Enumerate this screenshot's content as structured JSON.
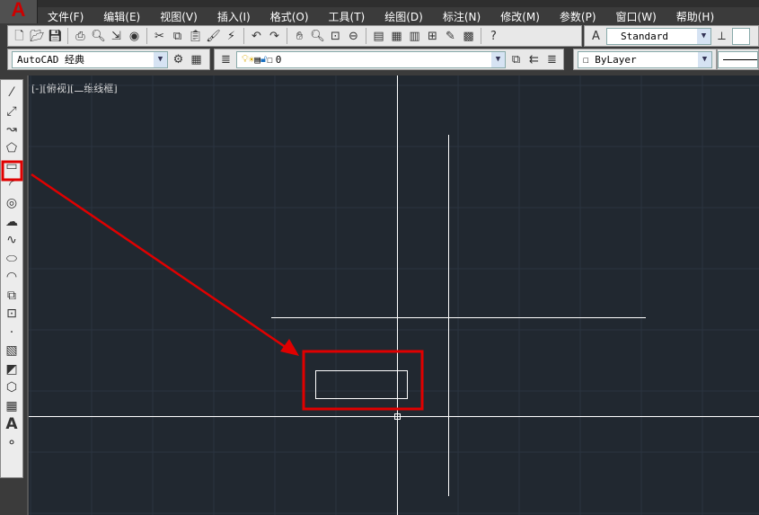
{
  "app": {
    "logo_letter": "A"
  },
  "menu": [
    "文件(F)",
    "编辑(E)",
    "视图(V)",
    "插入(I)",
    "格式(O)",
    "工具(T)",
    "绘图(D)",
    "标注(N)",
    "修改(M)",
    "参数(P)",
    "窗口(W)",
    "帮助(H)"
  ],
  "toolbar1": {
    "icons": [
      "new-icon",
      "open-icon",
      "save-icon",
      "print-icon",
      "print-preview-icon",
      "publish-icon",
      "3d-dwf-icon",
      "cut-icon",
      "copy-icon",
      "paste-icon",
      "match-properties-icon",
      "block-editor-icon",
      "undo-icon",
      "redo-icon",
      "pan-icon",
      "zoom-realtime-icon",
      "zoom-window-icon",
      "zoom-previous-icon",
      "properties-icon",
      "design-center-icon",
      "tool-palettes-icon",
      "sheet-set-icon",
      "markup-icon",
      "calculator-icon",
      "help-icon"
    ],
    "text_style_value": "Standard"
  },
  "toolbar2": {
    "workspace_value": "AutoCAD 经典",
    "layer_value": "0",
    "color_value": "ByLayer"
  },
  "viewport": {
    "label": "[-][俯视][二维线框]"
  },
  "draw_toolbar": {
    "items": [
      "line",
      "construction-line",
      "polyline",
      "polygon",
      "rectangle",
      "arc",
      "circle",
      "revision-cloud",
      "spline",
      "ellipse",
      "ellipse-arc",
      "insert-block",
      "make-block",
      "point",
      "hatch",
      "gradient",
      "region",
      "table",
      "multiline-text",
      "add-selected"
    ],
    "highlighted": "rectangle",
    "text_glyph": "A"
  },
  "colors": {
    "canvas": "#212830",
    "annotation": "#e00000",
    "geometry": "#ffffff"
  }
}
